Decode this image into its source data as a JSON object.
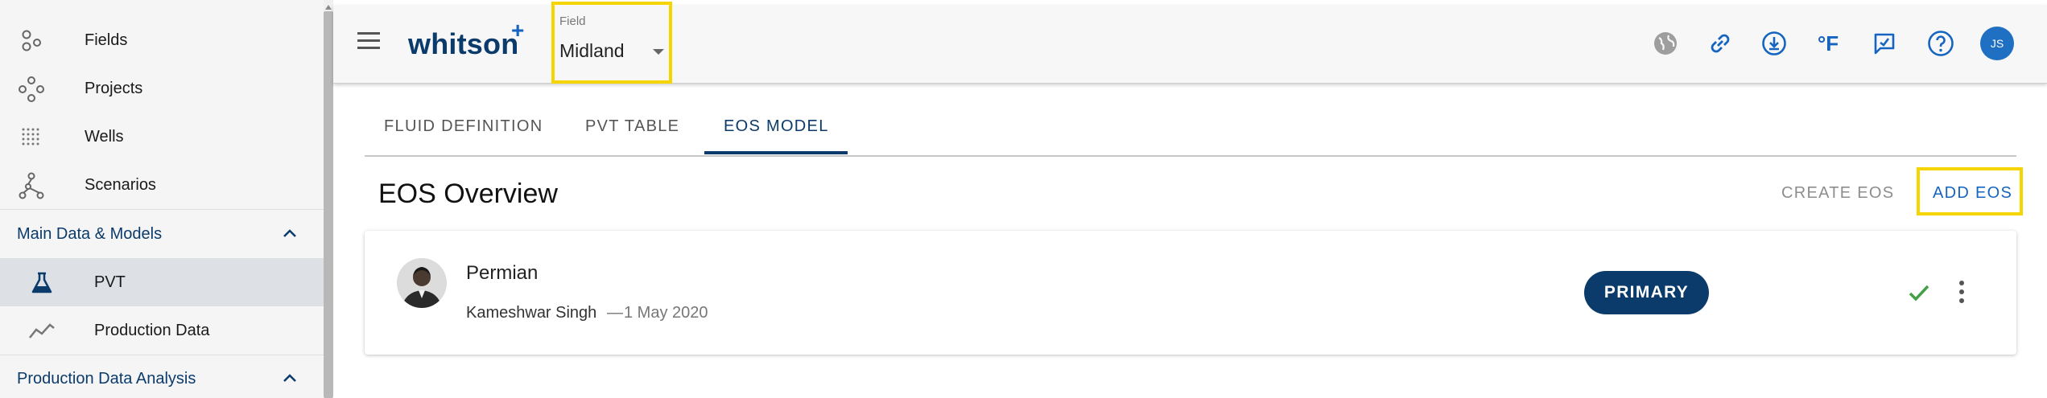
{
  "sidebar": {
    "items": [
      {
        "label": "Fields",
        "icon": "fields-icon"
      },
      {
        "label": "Projects",
        "icon": "projects-icon"
      },
      {
        "label": "Wells",
        "icon": "wells-icon"
      },
      {
        "label": "Scenarios",
        "icon": "scenarios-icon"
      }
    ],
    "section_main": "Main Data & Models",
    "sub_items": [
      {
        "label": "PVT",
        "icon": "flask-icon",
        "active": true
      },
      {
        "label": "Production Data",
        "icon": "trend-icon"
      }
    ],
    "section_pda": "Production Data Analysis"
  },
  "header": {
    "brand": "whitson",
    "brand_plus": "+",
    "field_caption": "Field",
    "field_value": "Midland",
    "avatar_initials": "JS",
    "tools": [
      "globe-icon",
      "link-icon",
      "download-icon",
      "fahrenheit-icon",
      "feedback-icon",
      "help-icon"
    ],
    "fahrenheit_label": "°F"
  },
  "tabs": [
    {
      "label": "FLUID DEFINITION"
    },
    {
      "label": "PVT TABLE"
    },
    {
      "label": "EOS MODEL",
      "active": true
    }
  ],
  "overview": {
    "title": "EOS Overview",
    "create_label": "CREATE EOS",
    "add_label": "ADD EOS"
  },
  "eos_card": {
    "name": "Permian",
    "author": "Kameshwar Singh",
    "separator": "—",
    "date": "1 May 2020",
    "badge": "PRIMARY"
  },
  "colors": {
    "navy": "#0b3b6b",
    "blue": "#1565c0",
    "highlight": "#f5d400",
    "check_green": "#43a047"
  }
}
